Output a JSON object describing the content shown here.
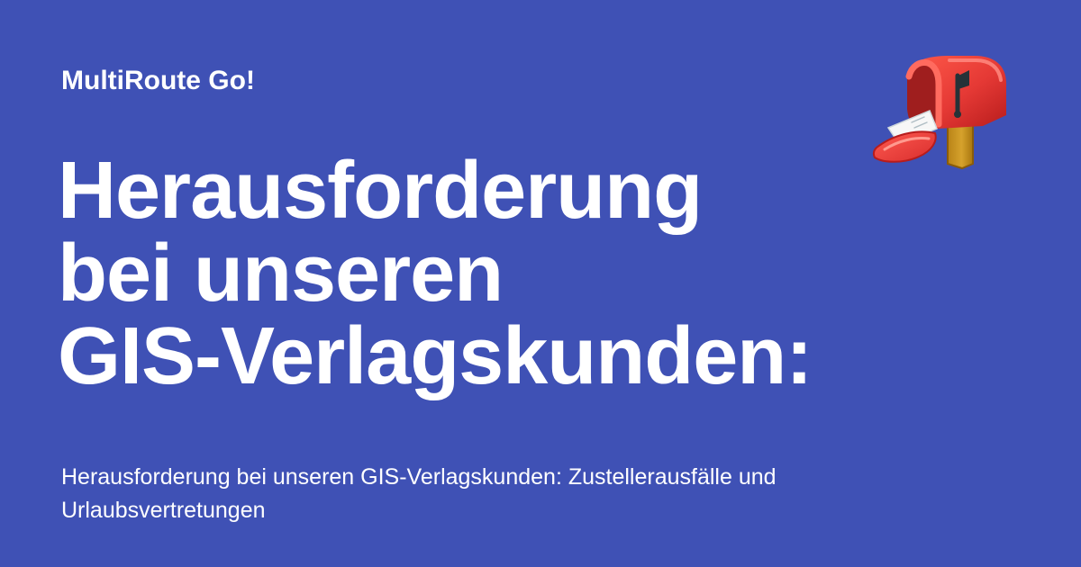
{
  "brand": "MultiRoute Go!",
  "headline": {
    "line_1": "Herausforderung",
    "line_2": "bei unseren",
    "line_3": "GIS-Verlagskunden:"
  },
  "subtitle": "Herausforderung bei unseren GIS-Verlagskunden: Zustellerausfälle und Urlaubsvertretungen",
  "illustration": "mailbox-icon",
  "colors": {
    "background": "#3f51b5",
    "text": "#ffffff",
    "mailbox_red": "#e53935",
    "post_yellow": "#c7951e",
    "flag_dark": "#263238"
  }
}
